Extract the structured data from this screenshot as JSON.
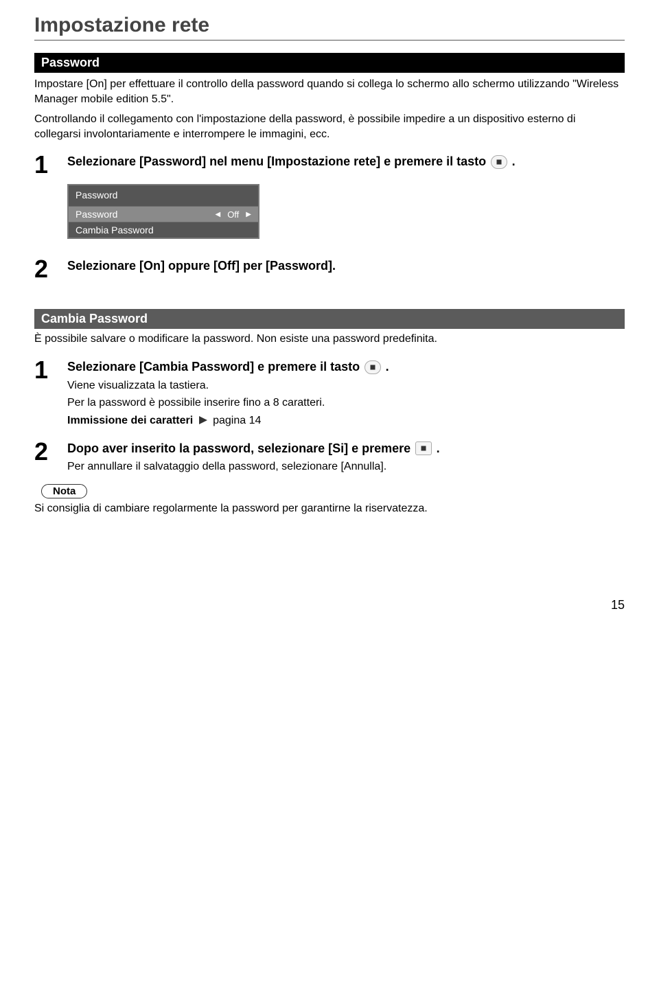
{
  "title": "Impostazione rete",
  "section1": {
    "header": "Password",
    "intro1": "Impostare [On] per effettuare il controllo della password quando si collega lo schermo allo schermo utilizzando \"Wireless Manager mobile edition 5.5\".",
    "intro2": "Controllando il collegamento con l'impostazione della password, è possibile impedire a un dispositivo esterno di collegarsi involontariamente e interrompere le immagini, ecc.",
    "step1_num": "1",
    "step1_text": "Selezionare [Password] nel menu [Impostazione rete] e premere il tasto ",
    "step1_suffix": ".",
    "osd": {
      "title": "Password",
      "row1_label": "Password",
      "row1_value": "Off",
      "row2_label": "Cambia Password"
    },
    "step2_num": "2",
    "step2_text": "Selezionare [On] oppure [Off] per [Password]."
  },
  "section2": {
    "header": "Cambia Password",
    "intro": "È possibile salvare o modificare la password. Non esiste una password predefinita.",
    "step1_num": "1",
    "step1_text": "Selezionare [Cambia Password] e premere il tasto ",
    "step1_suffix": ".",
    "step1_sub1": "Viene visualizzata la tastiera.",
    "step1_sub2": "Per la password è possibile inserire fino a 8 caratteri.",
    "step1_sub3a": "Immissione dei caratteri",
    "step1_sub3b": "pagina 14",
    "step2_num": "2",
    "step2_text": "Dopo aver inserito la password, selezionare [Si] e premere ",
    "step2_suffix": ".",
    "step2_sub": "Per annullare il salvataggio della password, selezionare [Annulla].",
    "nota_label": "Nota",
    "nota_text": "Si consiglia di cambiare regolarmente la password per garantirne la riservatezza."
  },
  "page_number": "15"
}
